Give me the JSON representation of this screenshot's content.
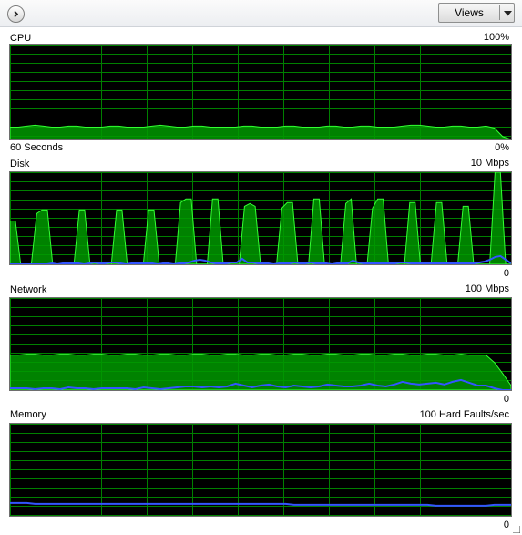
{
  "toolbar": {
    "nav_icon": "chevron-right-icon",
    "views_label": "Views",
    "dropdown_icon": "dropdown-arrow-icon"
  },
  "colors": {
    "graph_bg": "#000000",
    "grid": "#008000",
    "fill": "#009900",
    "fill_edge": "#33ff33",
    "io_line": "#3355ff"
  },
  "graphs": {
    "cpu": {
      "title": "CPU",
      "max": "100%",
      "time_label": "60 Seconds",
      "min": "0%"
    },
    "disk": {
      "title": "Disk",
      "max": "10 Mbps",
      "min": "0"
    },
    "network": {
      "title": "Network",
      "max": "100 Mbps",
      "min": "0"
    },
    "memory": {
      "title": "Memory",
      "max": "100 Hard Faults/sec",
      "min": "0"
    }
  },
  "series": {
    "cpu": [
      13,
      13,
      14,
      15,
      14,
      13,
      13,
      14,
      14,
      13,
      13,
      13,
      14,
      14,
      13,
      13,
      13,
      14,
      15,
      14,
      13,
      13,
      14,
      14,
      13,
      13,
      13,
      13,
      14,
      14,
      13,
      13,
      13,
      14,
      14,
      13,
      13,
      13,
      14,
      14,
      13,
      13,
      14,
      14,
      13,
      13,
      13,
      14,
      15,
      15,
      14,
      13,
      13,
      14,
      14,
      13,
      13,
      14,
      12,
      3,
      0
    ],
    "disk_fill": [
      47,
      47,
      0,
      0,
      0,
      55,
      59,
      59,
      0,
      0,
      0,
      0,
      0,
      59,
      59,
      0,
      0,
      0,
      0,
      0,
      59,
      59,
      0,
      0,
      0,
      0,
      59,
      59,
      0,
      0,
      0,
      0,
      67,
      71,
      71,
      0,
      0,
      0,
      71,
      71,
      0,
      0,
      0,
      0,
      63,
      66,
      63,
      0,
      0,
      0,
      0,
      61,
      67,
      67,
      0,
      0,
      0,
      71,
      71,
      0,
      0,
      0,
      0,
      66,
      71,
      0,
      0,
      0,
      61,
      71,
      71,
      0,
      0,
      0,
      0,
      67,
      67,
      0,
      0,
      0,
      67,
      67,
      0,
      0,
      0,
      63,
      63,
      0,
      0,
      0,
      0,
      100,
      100,
      0,
      0
    ],
    "disk_line": [
      0,
      0,
      0,
      0,
      0,
      0,
      0,
      0,
      1,
      0,
      1,
      1,
      1,
      1,
      0,
      1,
      2,
      1,
      1,
      2,
      2,
      1,
      0,
      1,
      1,
      1,
      1,
      1,
      0,
      1,
      1,
      0,
      1,
      1,
      2,
      4,
      5,
      4,
      2,
      1,
      1,
      1,
      2,
      2,
      6,
      2,
      2,
      1,
      1,
      1,
      0,
      1,
      1,
      1,
      2,
      1,
      1,
      2,
      1,
      1,
      1,
      0,
      1,
      1,
      1,
      4,
      2,
      1,
      1,
      1,
      1,
      1,
      1,
      1,
      2,
      2,
      1,
      1,
      1,
      1,
      1,
      1,
      1,
      1,
      1,
      1,
      1,
      1,
      1,
      2,
      3,
      5,
      8,
      9,
      5,
      1
    ],
    "net_fill": [
      38,
      38,
      39,
      39,
      38,
      38,
      39,
      39,
      38,
      38,
      39,
      39,
      38,
      38,
      39,
      39,
      38,
      38,
      39,
      39,
      38,
      38,
      39,
      39,
      38,
      38,
      39,
      39,
      38,
      38,
      39,
      39,
      38,
      38,
      39,
      39,
      38,
      38,
      39,
      39,
      38,
      38,
      39,
      39,
      38,
      38,
      39,
      39,
      38,
      38,
      39,
      39,
      38,
      38,
      39,
      38,
      38,
      38,
      30,
      18,
      5
    ],
    "net_line": [
      2,
      2,
      2,
      1,
      2,
      2,
      1,
      3,
      2,
      2,
      1,
      2,
      2,
      2,
      2,
      1,
      3,
      2,
      1,
      2,
      3,
      4,
      4,
      3,
      4,
      3,
      4,
      7,
      5,
      3,
      5,
      6,
      4,
      3,
      5,
      4,
      3,
      4,
      6,
      5,
      4,
      4,
      5,
      7,
      5,
      4,
      6,
      9,
      7,
      6,
      7,
      8,
      6,
      9,
      11,
      8,
      5,
      5,
      2,
      0,
      0
    ],
    "mem_line": [
      14,
      14,
      14,
      13,
      13,
      13,
      13,
      13,
      13,
      13,
      13,
      13,
      13,
      13,
      13,
      13,
      13,
      13,
      13,
      13,
      13,
      13,
      13,
      13,
      13,
      13,
      13,
      13,
      13,
      13,
      13,
      13,
      13,
      13,
      12,
      12,
      12,
      12,
      12,
      12,
      12,
      12,
      12,
      12,
      12,
      12,
      12,
      12,
      12,
      12,
      12,
      11,
      11,
      11,
      11,
      11,
      11,
      11,
      12,
      12,
      12
    ]
  }
}
